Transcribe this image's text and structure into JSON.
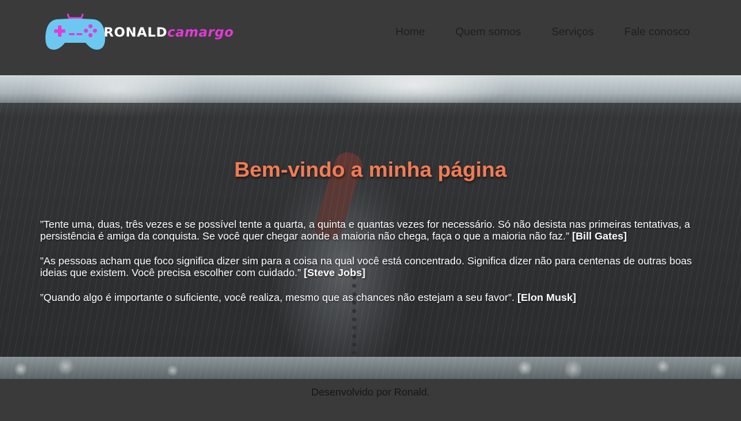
{
  "header": {
    "logo": {
      "first_name": "RONALD",
      "last_name": "camargo",
      "icon": "gamepad-icon",
      "colors": {
        "controller": "#6cc8f0",
        "accent": "#e23bd6"
      }
    },
    "nav": [
      {
        "label": "Home"
      },
      {
        "label": "Quem somos"
      },
      {
        "label": "Serviços"
      },
      {
        "label": "Fale conosco"
      }
    ]
  },
  "hero": {
    "title": "Bem-vindo a minha página",
    "quotes": [
      {
        "text": "”Tente uma, duas, três vezes e se possível tente a quarta, a quinta e quantas vezes for necessário. Só não desista nas primeiras tentativas, a persistência é amiga da conquista. Se você quer chegar aonde a maioria não chega, faça o que a maioria não faz.” ",
        "author": "[Bill Gates]"
      },
      {
        "text": "”As pessoas acham que foco significa dizer sim para a coisa na qual você está concentrado. Significa dizer não para centenas de outras boas ideias que existem. Você precisa escolher com cuidado.” ",
        "author": "[Steve Jobs]"
      },
      {
        "text": "”Quando algo é importante o suficiente, você realiza, mesmo que as chances não estejam a seu favor”. ",
        "author": "[Elon Musk]"
      }
    ]
  },
  "footer": {
    "text": "Desenvolvido por Ronald."
  },
  "colors": {
    "background": "#3a3a3a",
    "title": "#f27c55",
    "nav_text": "#1e1e1e"
  }
}
